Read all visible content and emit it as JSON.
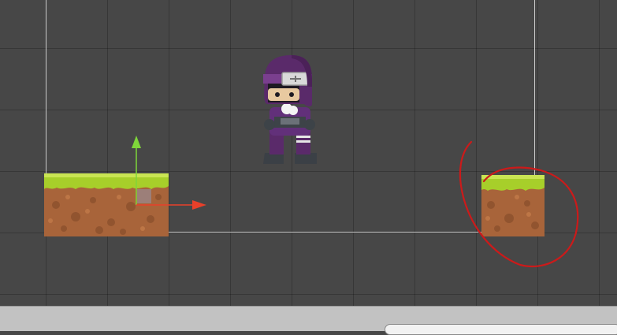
{
  "scene": {
    "background_color": "#474747",
    "grid_color": "#3a3a3a",
    "camera_bounds_color": "#c9c9c9"
  },
  "platforms": {
    "grass_color": "#a7cf2a",
    "dirt_color": "#a8643a",
    "dirt_dark_color": "#8a4f2c"
  },
  "gizmo": {
    "x_axis_color": "#e8402a",
    "y_axis_color": "#7fd63a",
    "center_color": "#8da0c8"
  },
  "annotation": {
    "color": "#cc1a1a"
  },
  "status_bar": {
    "search_placeholder": "",
    "icon": "search-icon"
  }
}
